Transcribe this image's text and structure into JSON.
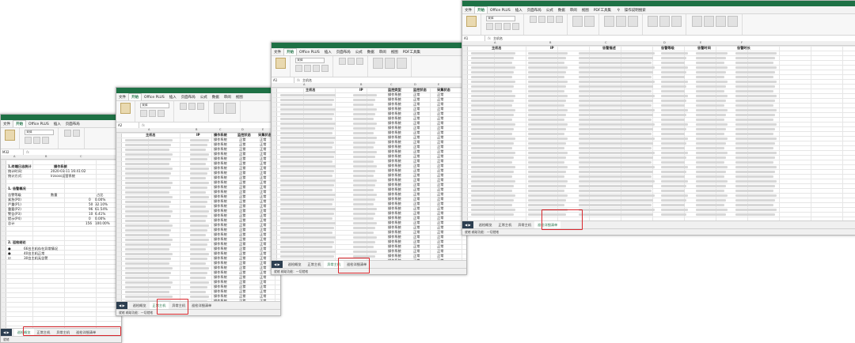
{
  "menu": [
    "文件",
    "开始",
    "Office PLUS",
    "插入",
    "页面布局",
    "公式",
    "数据",
    "审阅",
    "视图",
    "PDF工具集"
  ],
  "windows": {
    "w1": {
      "namebox": "M32",
      "font": "宋体",
      "report": {
        "title": "1.终端日志统计",
        "hdr": "操作系统",
        "r2a": "统计时间：",
        "r2b": "2020-03-11 16:41:02",
        "r3a": "统计方式：",
        "r3b": "lrzsoss运营系统",
        "sect": "1.  告警概况",
        "colh1": "告警等级",
        "colh2": "数量",
        "colh3": "占比",
        "rows": [
          {
            "label": "紧急(P0)",
            "count": "0",
            "pct": "0.00%"
          },
          {
            "label": "严重(P1)",
            "count": "50",
            "pct": "32.10%"
          },
          {
            "label": "重要(P2)",
            "count": "96",
            "pct": "61.54%"
          },
          {
            "label": "警告(P3)",
            "count": "10",
            "pct": "6.41%"
          },
          {
            "label": "提示(P4)",
            "count": "0",
            "pct": "0.00%"
          },
          {
            "label": "总计",
            "count": "156",
            "pct": "100.00%"
          }
        ],
        "sect2": "2.  巡检结论",
        "c1": "66台主机存在异常情况",
        "c2": "40台主机正常",
        "c3": "30台主机无告警"
      },
      "tabs": [
        "巡检概览",
        "正常主机",
        "异常主机",
        "巡检详细清单"
      ],
      "active_tab": 0,
      "status": "就绪"
    },
    "w2": {
      "namebox": "A2",
      "headers": [
        "主机名",
        "IP",
        "操作系统",
        "监控状态",
        "采集状态"
      ],
      "tabs": [
        "巡检概览",
        "正常主机",
        "异常主机",
        "巡检详细清单"
      ],
      "active_tab": 1,
      "cell_os": "操作系统",
      "cell_mon": "正常",
      "status": "就绪  辅助功能：一切就绪"
    },
    "w3": {
      "namebox": "A1",
      "fx": "主机名",
      "headers": [
        "主机名",
        "IP",
        "监控类型",
        "监控状态",
        "采集状态"
      ],
      "tabs": [
        "巡检概览",
        "正常主机",
        "异常主机",
        "巡检详细清单"
      ],
      "active_tab": 2,
      "status": "就绪  辅助功能：一切就绪"
    },
    "w4": {
      "namebox": "A1",
      "fx": "主机名",
      "search": "操作说明搜索",
      "headers": [
        "主机名",
        "IP",
        "告警描述",
        "告警等级",
        "告警时间",
        "告警时长"
      ],
      "tabs": [
        "巡检概览",
        "正常主机",
        "异常主机",
        "巡检详细清单"
      ],
      "active_tab": 3,
      "status": "就绪  辅助功能：一切就绪"
    }
  }
}
